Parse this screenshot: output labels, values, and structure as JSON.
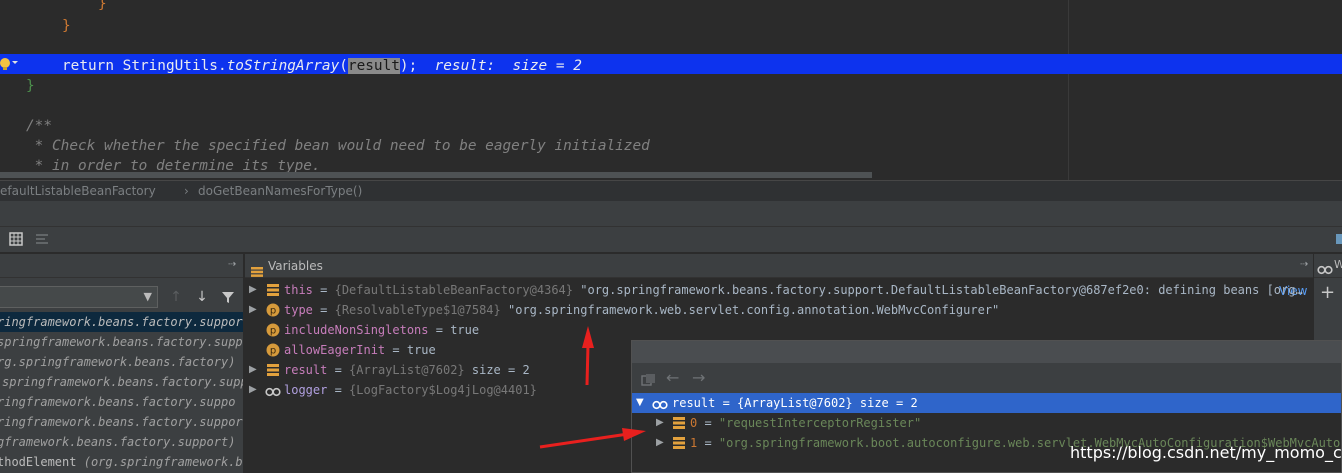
{
  "editor": {
    "line_brace_inner": "}",
    "line_brace_outer": "}",
    "return_kw": "return ",
    "return_class": "StringUtils.",
    "return_method": "toStringArray",
    "return_open": "(",
    "return_arg": "result",
    "return_close": ");",
    "inline_hint": "result:  size = 2",
    "method_close": "}",
    "comment_open": "/**",
    "comment_line1": " * Check whether the specified bean would need to be eagerly initialized",
    "comment_line2": " * in order to determine its type."
  },
  "breadcrumb": {
    "class_name": "efaultListableBeanFactory",
    "separator": "›",
    "method_name": "doGetBeanNamesForType()"
  },
  "frames": {
    "rows": [
      {
        "text": "ringframework.beans.factory.suppor",
        "selected": true
      },
      {
        "text": "springframework.beans.factory.support)"
      },
      {
        "text": "rg.springframework.beans.factory)"
      },
      {
        "text": "springframework.beans.factory.suppo"
      },
      {
        "text": "ringframework.beans.factory.suppo"
      },
      {
        "text": "ringframework.beans.factory.support"
      },
      {
        "text": "gframework.beans.factory.support)"
      }
    ],
    "last_row_method": "thodElement",
    "last_row_loc": "(org.springframework.bea"
  },
  "variables": {
    "title": "Variables",
    "view_link": "View",
    "rows": [
      {
        "name": "this",
        "eq": " = ",
        "type": "{DefaultListableBeanFactory@4364}",
        "value": " \"org.springframework.beans.factory.support.DefaultListableBeanFactory@687ef2e0: defining beans [org…"
      },
      {
        "name": "type",
        "eq": " = ",
        "type": "{ResolvableType$1@7584}",
        "value": " \"org.springframework.web.servlet.config.annotation.WebMvcConfigurer\""
      },
      {
        "name": "includeNonSingletons",
        "eq": " = ",
        "type": "",
        "value": "true"
      },
      {
        "name": "allowEagerInit",
        "eq": " = ",
        "type": "",
        "value": "true"
      },
      {
        "name": "result",
        "eq": " = ",
        "type": "{ArrayList@7602}",
        "value": "  size = 2"
      },
      {
        "name": "logger",
        "eq": " = ",
        "type": "{LogFactory$Log4jLog@4401}",
        "value": ""
      }
    ]
  },
  "popup": {
    "root": {
      "name": "result",
      "eq": " = ",
      "type": "{ArrayList@7602}",
      "value": "  size = 2"
    },
    "items": [
      {
        "index": "0",
        "eq": " = ",
        "value": "\"requestInterceptorRegister\""
      },
      {
        "index": "1",
        "eq": " = ",
        "value": "\"org.springframework.boot.autoconfigure.web.servlet.WebMvcAutoConfiguration$WebMvcAutoCon"
      }
    ]
  },
  "watches": {
    "label": "W",
    "add": "+"
  },
  "watermark": "https://blog.csdn.net/my_momo_csdn",
  "colors": {
    "execution_line": "#0d33ee",
    "selection": "#2f65ca",
    "annotation_arrow": "#e8201e"
  },
  "icons": {
    "bulb": "lightbulb-icon",
    "param": "parameter-icon",
    "field": "field-icon",
    "watch": "infinity-icon"
  }
}
